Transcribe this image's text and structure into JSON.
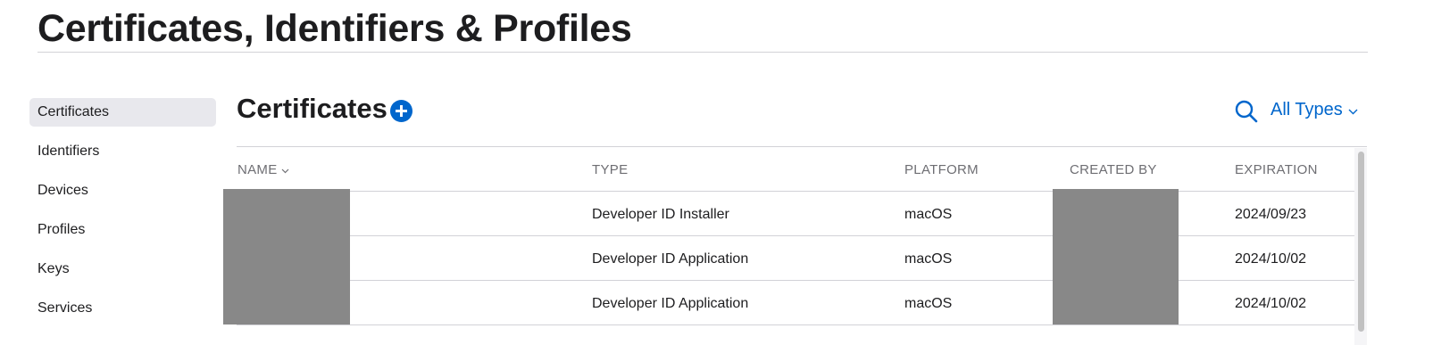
{
  "page": {
    "title": "Certificates, Identifiers & Profiles"
  },
  "sidebar": {
    "items": [
      {
        "label": "Certificates",
        "active": true
      },
      {
        "label": "Identifiers"
      },
      {
        "label": "Devices"
      },
      {
        "label": "Profiles"
      },
      {
        "label": "Keys"
      },
      {
        "label": "Services"
      }
    ]
  },
  "section": {
    "title": "Certificates",
    "add_icon": "plus-circle-icon",
    "search_icon": "search-icon",
    "filter_label": "All Types"
  },
  "table": {
    "columns": [
      "NAME",
      "TYPE",
      "PLATFORM",
      "CREATED BY",
      "EXPIRATION"
    ],
    "sorted_column": "NAME",
    "rows": [
      {
        "type": "Developer ID Installer",
        "platform": "macOS",
        "expiration": "2024/09/23"
      },
      {
        "type": "Developer ID Application",
        "platform": "macOS",
        "expiration": "2024/10/02"
      },
      {
        "type": "Developer ID Application",
        "platform": "macOS",
        "expiration": "2024/10/02"
      }
    ]
  },
  "colors": {
    "accent": "#0066cc",
    "redaction": "#888888",
    "divider": "#d2d2d7"
  }
}
